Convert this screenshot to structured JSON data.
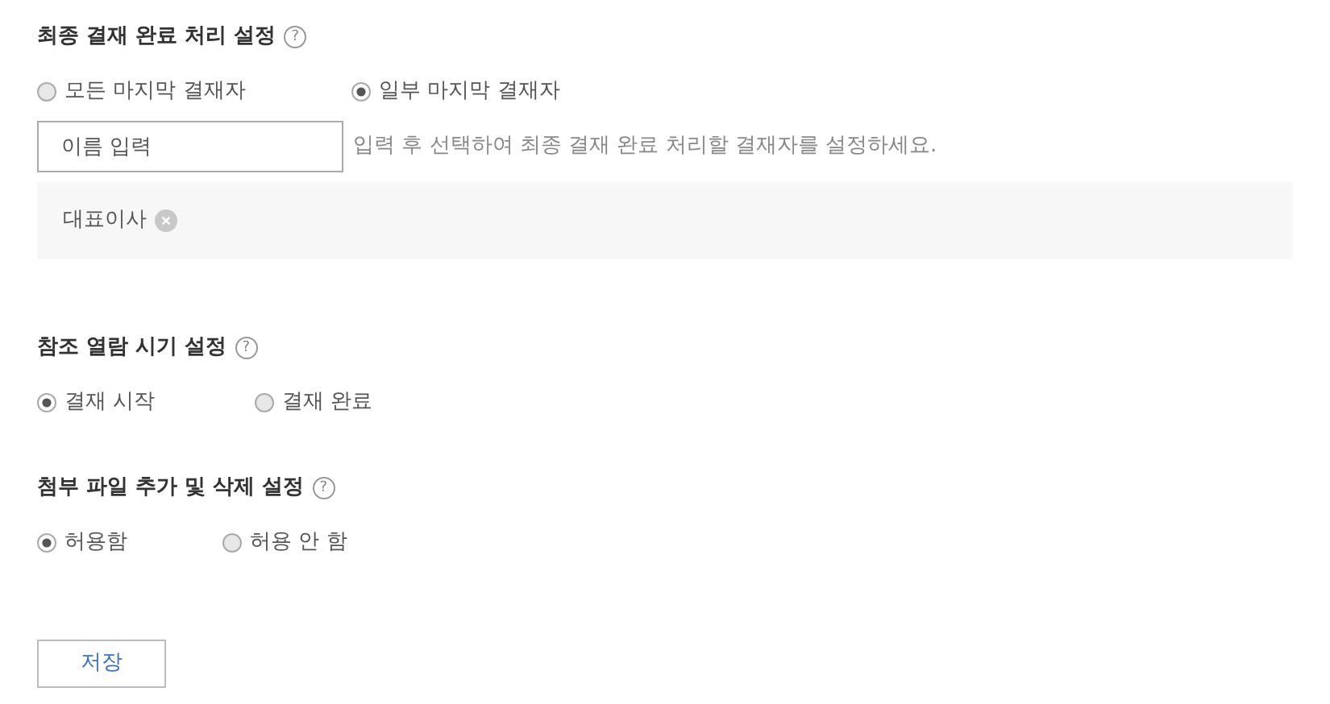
{
  "sections": [
    {
      "title": "최종 결재 완료 처리 설정",
      "help": "?",
      "options": [
        {
          "label": "모든 마지막 결재자",
          "selected": false
        },
        {
          "label": "일부 마지막 결재자",
          "selected": true
        }
      ],
      "name_field": {
        "placeholder": "이름 입력",
        "hint": "입력 후 선택하여 최종 결재 완료 처리할 결재자를 설정하세요."
      },
      "tags": [
        {
          "label": "대표이사"
        }
      ]
    },
    {
      "title": "참조 열람 시기 설정",
      "help": "?",
      "options": [
        {
          "label": "결재 시작",
          "selected": true
        },
        {
          "label": "결재 완료",
          "selected": false
        }
      ]
    },
    {
      "title": "첨부 파일 추가 및 삭제 설정",
      "help": "?",
      "options": [
        {
          "label": "허용함",
          "selected": true
        },
        {
          "label": "허용 안 함",
          "selected": false
        }
      ]
    }
  ],
  "save_button": "저장"
}
